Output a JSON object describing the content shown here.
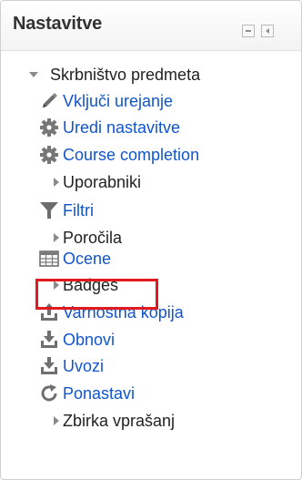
{
  "block": {
    "title": "Nastavitve"
  },
  "tree": {
    "root_label": "Skrbništvo predmeta",
    "items": [
      {
        "label": "Vključi urejanje",
        "icon": "pencil-icon",
        "kind": "link"
      },
      {
        "label": "Uredi nastavitve",
        "icon": "gear-icon",
        "kind": "link"
      },
      {
        "label": "Course completion",
        "icon": "gear-icon",
        "kind": "link"
      },
      {
        "label": "Uporabniki",
        "icon": "expand-arrow-icon",
        "kind": "branch"
      },
      {
        "label": "Filtri",
        "icon": "filter-icon",
        "kind": "link"
      },
      {
        "label": "Poročila",
        "icon": "expand-arrow-icon",
        "kind": "branch"
      },
      {
        "label": "Ocene",
        "icon": "gradebook-icon",
        "kind": "link",
        "highlighted": true
      },
      {
        "label": "Badges",
        "icon": "expand-arrow-icon",
        "kind": "branch"
      },
      {
        "label": "Varnostna kopija",
        "icon": "backup-upload-icon",
        "kind": "link"
      },
      {
        "label": "Obnovi",
        "icon": "restore-download-icon",
        "kind": "link"
      },
      {
        "label": "Uvozi",
        "icon": "import-download-icon",
        "kind": "link"
      },
      {
        "label": "Ponastavi",
        "icon": "reset-icon",
        "kind": "link"
      },
      {
        "label": "Zbirka vprašanj",
        "icon": "expand-arrow-icon",
        "kind": "branch"
      }
    ]
  },
  "colors": {
    "link": "#1155cc",
    "text": "#222222",
    "highlight_border": "#e2191f"
  }
}
